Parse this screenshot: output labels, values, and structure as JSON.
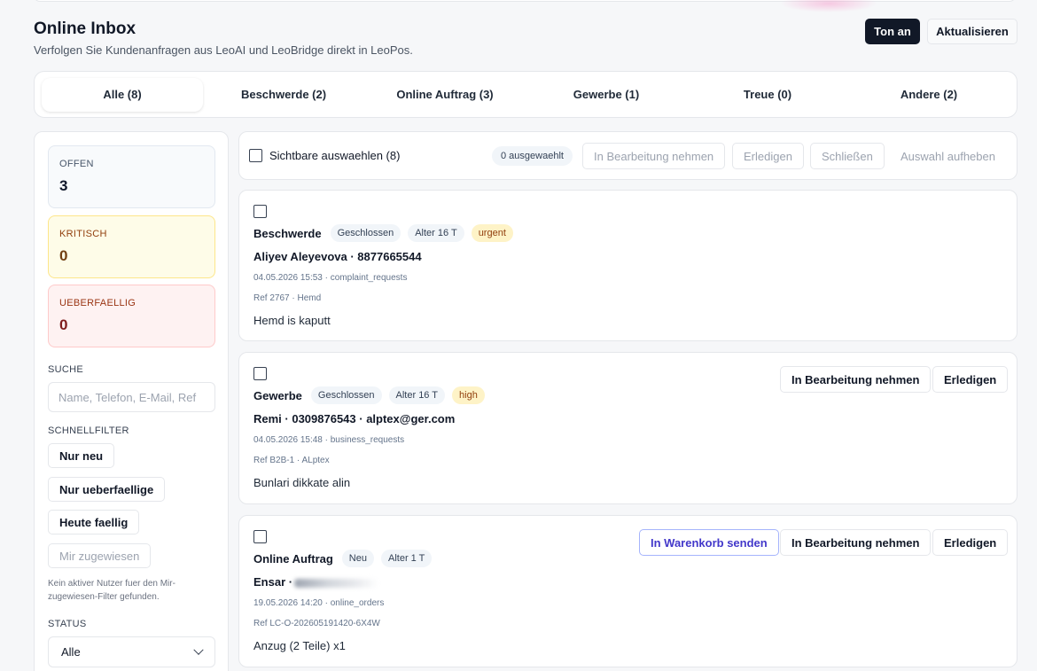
{
  "header": {
    "title": "Online Inbox",
    "subtitle": "Verfolgen Sie Kundenanfragen aus LeoAI und LeoBridge direkt in LeoPos.",
    "ton_button": "Ton an",
    "refresh_button": "Aktualisieren"
  },
  "tabs": [
    {
      "label": "Alle (8)",
      "active": true
    },
    {
      "label": "Beschwerde (2)",
      "active": false
    },
    {
      "label": "Online Auftrag (3)",
      "active": false
    },
    {
      "label": "Gewerbe (1)",
      "active": false
    },
    {
      "label": "Treue (0)",
      "active": false
    },
    {
      "label": "Andere (2)",
      "active": false
    }
  ],
  "sidebar": {
    "stats": {
      "offen": {
        "label": "OFFEN",
        "value": "3"
      },
      "kritisch": {
        "label": "KRITISCH",
        "value": "0"
      },
      "ueberfaellig": {
        "label": "UEBERFAELLIG",
        "value": "0"
      }
    },
    "search_label": "SUCHE",
    "search_placeholder": "Name, Telefon, E-Mail, Ref",
    "quickfilter_label": "SCHNELLFILTER",
    "quickfilters": [
      "Nur neu",
      "Nur ueberfaellige",
      "Heute faellig",
      "Mir zugewiesen"
    ],
    "hint": "Kein aktiver Nutzer fuer den Mir-zugewiesen-Filter gefunden.",
    "status_label": "STATUS",
    "status_value": "Alle"
  },
  "bulkbar": {
    "select_visible": "Sichtbare auswaehlen (8)",
    "selected_count": "0 ausgewaehlt",
    "take_over": "In Bearbeitung nehmen",
    "done": "Erledigen",
    "close": "Schließen",
    "clear": "Auswahl aufheben"
  },
  "cards": [
    {
      "type": "Beschwerde",
      "status": "Geschlossen",
      "age": "Alter 16 T",
      "priority": "urgent",
      "name": "Aliyev Aleyevova · 8877665544",
      "meta": "04.05.2026 15:53 · complaint_requests",
      "ref": "Ref 2767 · Hemd",
      "message": "Hemd is kaputt"
    },
    {
      "type": "Gewerbe",
      "status": "Geschlossen",
      "age": "Alter 16 T",
      "priority": "high",
      "name": "Remi · 0309876543 · alptex@ger.com",
      "meta": "04.05.2026 15:48 · business_requests",
      "ref": "Ref B2B-1 · ALptex",
      "message": "Bunlari dikkate alin",
      "btn_take": "In Bearbeitung nehmen",
      "btn_done": "Erledigen"
    },
    {
      "type": "Online Auftrag",
      "status": "Neu",
      "age": "Alter 1 T",
      "name": "Ensar ·",
      "meta": "19.05.2026 14:20 · online_orders",
      "ref": "Ref LC-O-202605191420-6X4W",
      "message": "Anzug (2 Teile) x1",
      "btn_cart": "In Warenkorb senden",
      "btn_take": "In Bearbeitung nehmen",
      "btn_done": "Erledigen"
    }
  ]
}
